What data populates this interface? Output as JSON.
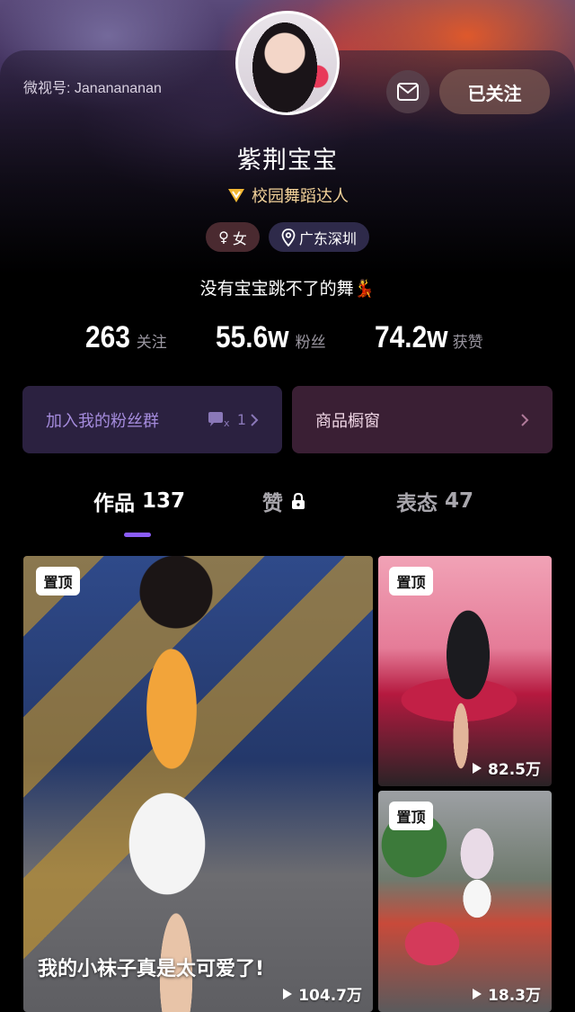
{
  "profile": {
    "wechat_id": "微视号: Jananananan",
    "nickname": "紫荆宝宝",
    "badge": "校园舞蹈达人",
    "gender": "女",
    "location": "广东深圳",
    "bio": "没有宝宝跳不了的舞💃"
  },
  "actions": {
    "follow_label": "已关注"
  },
  "stats": {
    "following_num": "263",
    "following_label": "关注",
    "fans_num": "55.6w",
    "fans_label": "粉丝",
    "likes_num": "74.2w",
    "likes_label": "获赞"
  },
  "cards": {
    "fans_group": "加入我的粉丝群",
    "fans_group_count": "1",
    "shop": "商品橱窗"
  },
  "tabs": [
    {
      "label": "作品",
      "count": "137"
    },
    {
      "label": "赞",
      "count": ""
    },
    {
      "label": "表态",
      "count": "47"
    }
  ],
  "videos": [
    {
      "pin": "置顶",
      "caption": "我的小袜子真是太可爱了!",
      "plays": "104.7万"
    },
    {
      "pin": "置顶",
      "caption": "",
      "plays": "82.5万"
    },
    {
      "pin": "置顶",
      "caption": "",
      "plays": "18.3万"
    }
  ],
  "colors": {
    "accent": "#8a5cf6",
    "badge_gold": "#f4d39a",
    "fans_card": "#2b2140",
    "shop_card": "#3a1f34"
  }
}
